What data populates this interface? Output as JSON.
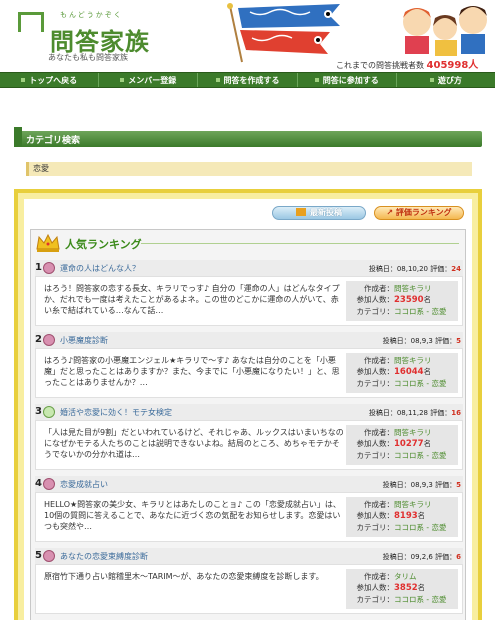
{
  "header": {
    "logo_ruby": "もんどうかぞく",
    "logo_title": "問答家族",
    "logo_sub": "あなたも私も問答家族",
    "counter_label": "これまでの問答挑戦者数",
    "counter_value": "405998人"
  },
  "nav": {
    "items": [
      {
        "label": "トップへ戻る"
      },
      {
        "label": "メンバー登録"
      },
      {
        "label": "問答を作成する"
      },
      {
        "label": "問答に参加する"
      },
      {
        "label": "遊び方"
      }
    ]
  },
  "category": {
    "header_label": "カテゴリ検索",
    "current": "恋愛"
  },
  "buttons": {
    "latest": "最新投稿",
    "ranking": "評価ランキング"
  },
  "ranking": {
    "title": "人気ランキング",
    "info_labels": {
      "author": "作成者：",
      "participants": "参加人数：",
      "category": "カテゴリ：",
      "posted": "投稿日：",
      "rating": "評価："
    },
    "entries": [
      {
        "rank": "1",
        "title": "運命の人はどんな人？",
        "posted": "08,10,20",
        "score": "24",
        "desc": "はろう！問答家の恋する長女、キラリでっす♪ 自分の「運命の人」はどんなタイプか、だれでも一度は考えたことがあるよネ。この世のどこかに運命の人がいて、赤い糸で結ばれている…なんて話…",
        "author": "問答キラリ",
        "participants": "23590",
        "participants_unit": "名",
        "category": "ココロ系 - 恋愛"
      },
      {
        "rank": "2",
        "title": "小悪魔度診断",
        "posted": "08,9,3",
        "score": "5",
        "desc": "はろう♪問答家の小悪魔エンジェル★キラリで〜す♪ あなたは自分のことを「小悪魔」だと思ったことはありますか？また、今までに「小悪魔になりたい！」と、思ったことはありませんか？…",
        "author": "問答キラリ",
        "participants": "16044",
        "participants_unit": "名",
        "category": "ココロ系 - 恋愛"
      },
      {
        "rank": "3",
        "title": "婚活や恋愛に効く！モテ女検定",
        "posted": "08,11,28",
        "score": "16",
        "desc": "「人は見た目が9割」だといわれているけど、それじゃあ、ルックスはいまいちなのになぜかモテる人たちのことは説明できないよね。結局のところ、めちゃモテかそうでないかの分かれ道は…",
        "author": "問答キラリ",
        "participants": "10277",
        "participants_unit": "名",
        "category": "ココロ系 - 恋愛"
      },
      {
        "rank": "4",
        "title": "恋愛成就占い",
        "posted": "08,9,3",
        "score": "5",
        "desc": "HELLO★問答家の美少女、キラリとはあたしのことョ♪ この「恋愛成就占い」は、10個の質問に答えることで、あなたに近づく恋の気配をお知らせします。恋愛はいつも突然や…",
        "author": "問答キラリ",
        "participants": "8193",
        "participants_unit": "名",
        "category": "ココロ系 - 恋愛"
      },
      {
        "rank": "5",
        "title": "あなたの恋愛束縛度診断",
        "posted": "09,2,6",
        "score": "6",
        "desc": "原宿竹下通り占い館稽里木〜TARIM〜が、あなたの恋愛束縛度を診断します。",
        "author": "タリム",
        "participants": "3852",
        "participants_unit": "名",
        "category": "ココロ系 - 恋愛"
      }
    ]
  },
  "colors": {
    "brand_green": "#3b7a2a",
    "panel_yellow": "#e8cf3c",
    "accent_red": "#e03030"
  }
}
